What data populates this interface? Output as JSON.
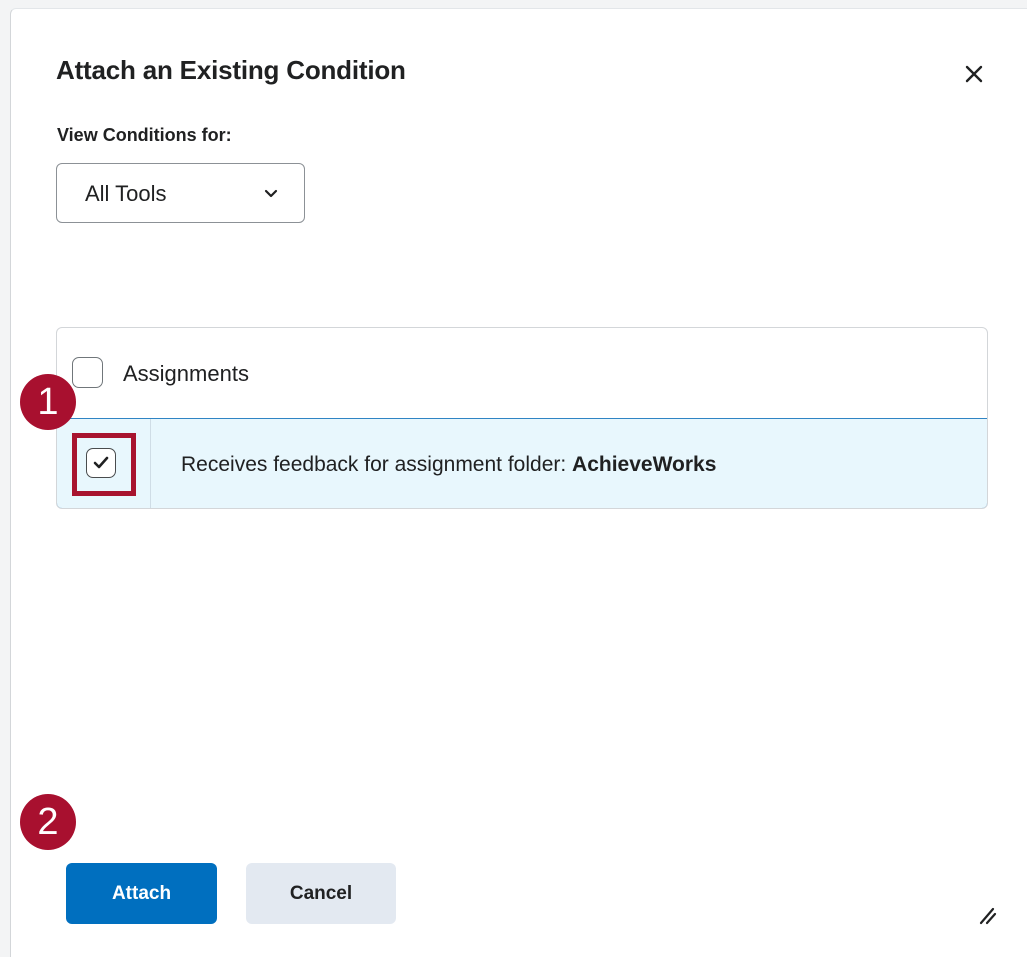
{
  "dialog": {
    "title": "Attach an Existing Condition",
    "close_icon": "close-icon"
  },
  "filter": {
    "label": "View Conditions for:",
    "selected": "All Tools",
    "chevron_icon": "chevron-down-icon"
  },
  "conditions": {
    "group_label": "Assignments",
    "group_checked": false,
    "items": [
      {
        "prefix": "Receives feedback for assignment folder: ",
        "name": "AchieveWorks",
        "checked": true
      }
    ]
  },
  "callouts": {
    "step1": "1",
    "step2": "2",
    "color": "#a8102f"
  },
  "footer": {
    "attach_label": "Attach",
    "cancel_label": "Cancel",
    "resize_icon": "resize-handle-icon"
  },
  "colors": {
    "primary": "#006fbf",
    "selected_row_bg": "#e8f7fd",
    "selected_row_border": "#2f84c4"
  }
}
